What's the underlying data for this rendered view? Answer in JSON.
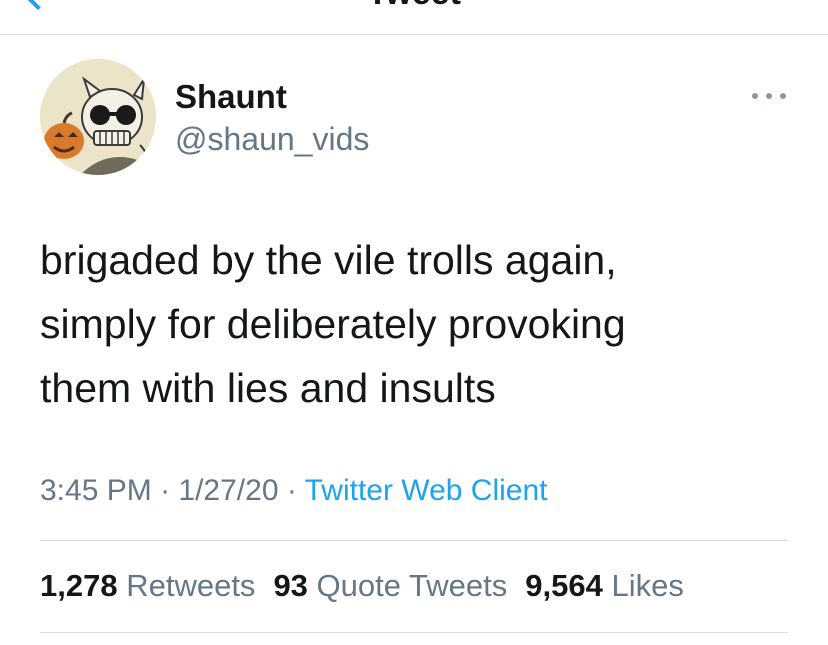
{
  "nav": {
    "title": "Tweet"
  },
  "author": {
    "display_name": "Shaunt",
    "handle": "@shaun_vids"
  },
  "tweet": {
    "lines": [
      "brigaded by the vile trolls again,",
      "simply for deliberately provoking",
      "them with lies and insults"
    ]
  },
  "meta": {
    "time": "3:45 PM",
    "sep1": " · ",
    "date": "1/27/20",
    "sep2": " · ",
    "source": "Twitter Web Client"
  },
  "stats": {
    "retweets_count": "1,278",
    "retweets_label": "Retweets",
    "quotes_count": "93",
    "quotes_label": "Quote Tweets",
    "likes_count": "9,564",
    "likes_label": "Likes"
  },
  "colors": {
    "accent": "#1da1f2",
    "text": "#14171a",
    "secondary": "#657786",
    "divider": "#d9dde1"
  },
  "icons": {
    "back": "chevron-left-icon",
    "more": "more-horizontal-icon"
  }
}
